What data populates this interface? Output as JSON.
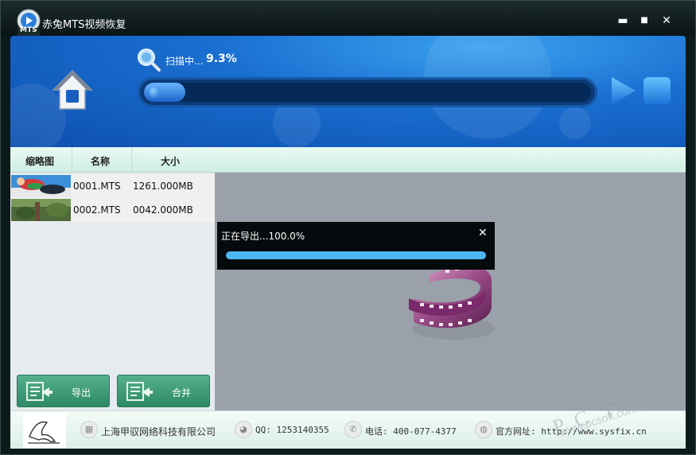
{
  "window": {
    "title": "赤兔MTS视频恢复",
    "logo_text": "MTS",
    "minimize": "▬",
    "maximize": "■",
    "close": "✕"
  },
  "scan": {
    "label": "扫描中...",
    "percent": "9.3%",
    "progress_fraction": 0.093
  },
  "table": {
    "columns": [
      "缩略图",
      "名称",
      "大小"
    ],
    "rows": [
      {
        "name": "0001.MTS",
        "size": "1261.000MB"
      },
      {
        "name": "0002.MTS",
        "size": "0042.000MB"
      }
    ]
  },
  "actions": {
    "export_label": "导出",
    "merge_label": "合并"
  },
  "export_dialog": {
    "title": "正在导出...100.0%",
    "close": "✕",
    "progress_fraction": 1.0
  },
  "footer": {
    "company": "上海甲驭网络科技有限公司",
    "qq": "QQ: 1253140355",
    "phone": "电话: 400-077-4377",
    "website": "官方网址: http://www.sysfix.cn"
  },
  "watermark": {
    "main": "P C 下 载 网",
    "sub": "www.pcsoft.com.cn"
  },
  "colors": {
    "header_blue": "#1a6fd0",
    "button_green": "#3f9f7a",
    "progress_blue": "#4db6f2"
  }
}
